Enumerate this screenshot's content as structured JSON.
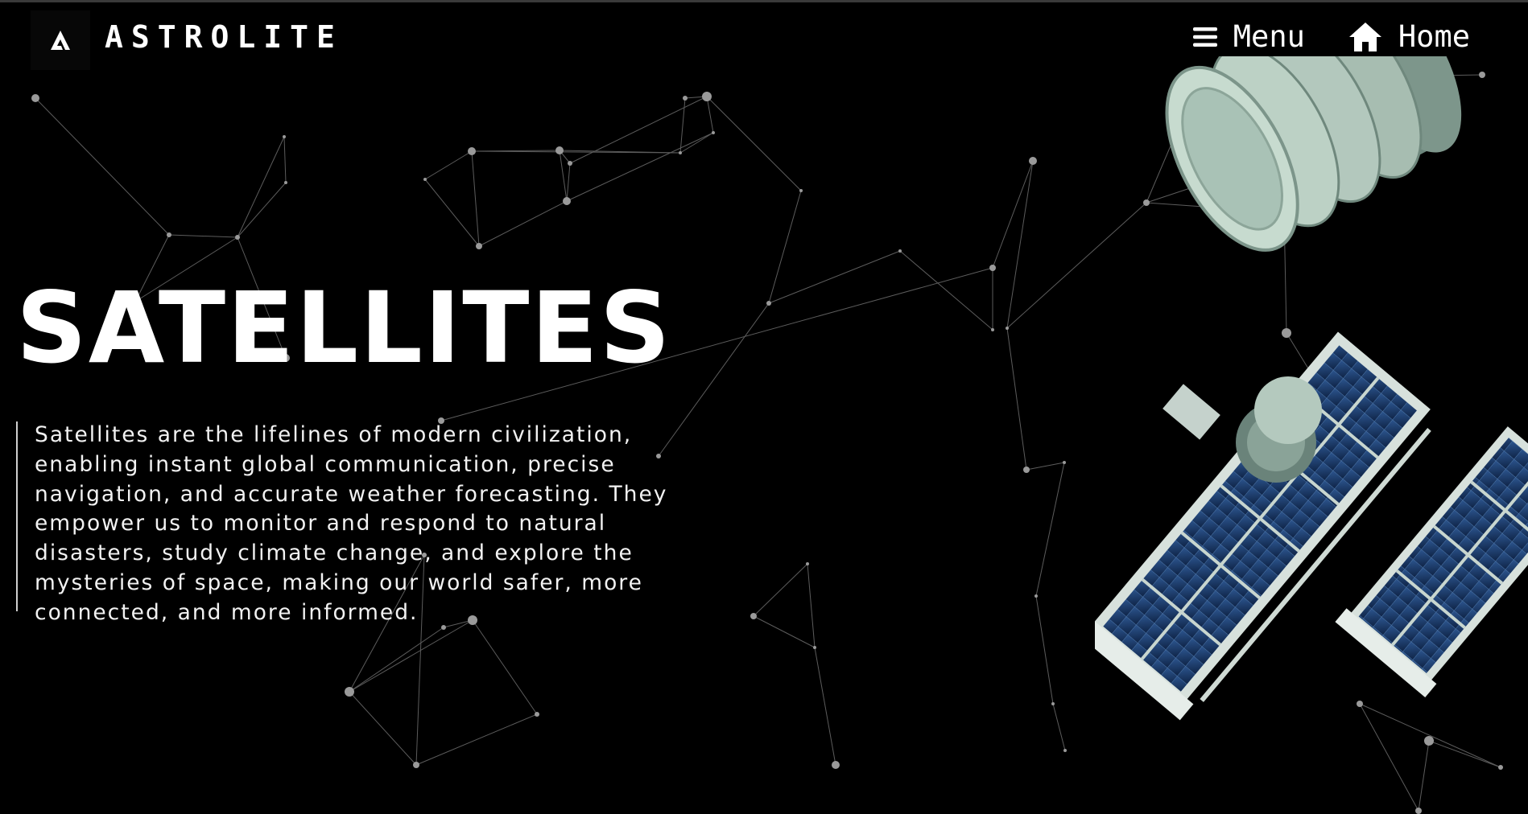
{
  "header": {
    "logo_icon": "astrolite-a-icon",
    "brand_name": "ASTROLITE",
    "nav": {
      "menu_icon": "hamburger-icon",
      "menu_label": "Menu",
      "home_icon": "home-icon",
      "home_label": "Home"
    }
  },
  "hero": {
    "title": "SATELLITES",
    "description": "Satellites are the lifelines of modern civilization, enabling instant global communication, precise navigation, and accurate weather forecasting. They empower us to monitor and respond to natural disasters, study climate change, and explore the mysteries of space, making our world safer, more connected, and more informed."
  },
  "colors": {
    "background": "#000000",
    "text": "#ffffff",
    "network_lines": "#5a5a5a",
    "solar_panel": "#1f3f6e",
    "module_body": "#a9c2b4"
  }
}
